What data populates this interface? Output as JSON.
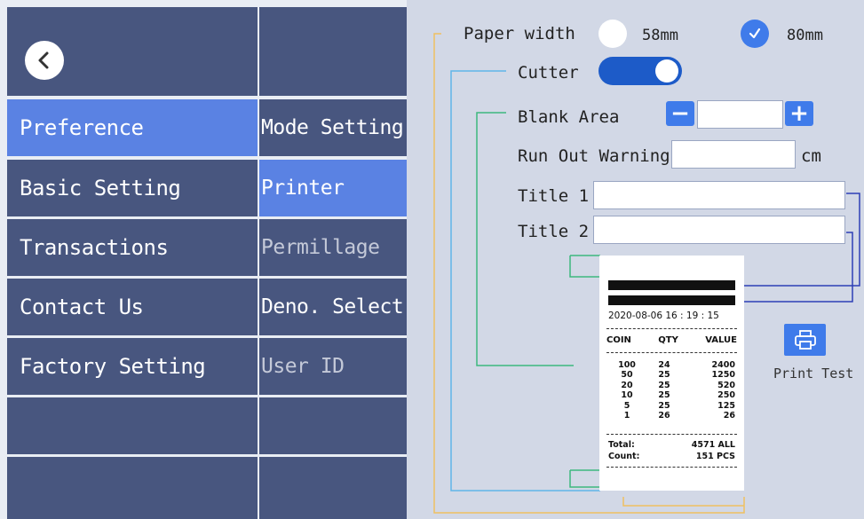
{
  "nav": {
    "back_icon": "chevron-left-icon",
    "primary": [
      "Preference",
      "Basic Setting",
      "Transactions",
      "Contact Us",
      "Factory Setting"
    ],
    "secondary": [
      "Mode Setting",
      "Printer",
      "Permillage",
      "Deno. Select",
      "User ID"
    ]
  },
  "printer": {
    "paper_width_label": "Paper width",
    "option_58": "58mm",
    "option_80": "80mm",
    "selected_width": "80mm",
    "cutter_label": "Cutter",
    "cutter_on": true,
    "blank_area_label": "Blank Area",
    "blank_area_value": "",
    "run_out_warning_label": "Run Out Warning",
    "run_out_warning_value": "",
    "run_out_unit": "cm",
    "title1_label": "Title 1",
    "title1_value": "",
    "title2_label": "Title 2",
    "title2_value": "",
    "print_test_label": "Print Test",
    "print_icon": "printer-icon"
  },
  "receipt": {
    "datetime": "2020-08-06 16 : 19 : 15",
    "headers": [
      "COIN",
      "QTY",
      "VALUE"
    ],
    "rows": [
      [
        "100",
        "24",
        "2400"
      ],
      [
        "50",
        "25",
        "1250"
      ],
      [
        "20",
        "25",
        "520"
      ],
      [
        "10",
        "25",
        "250"
      ],
      [
        "5",
        "25",
        "125"
      ],
      [
        "1",
        "26",
        "26"
      ]
    ],
    "total_label": "Total:",
    "total_value": "4571 ALL",
    "count_label": "Count:",
    "count_value": "151 PCS"
  },
  "colors": {
    "nav_bg": "#48567f",
    "nav_active": "#5a82e3",
    "accent": "#3f7bea",
    "panel_bg": "#d2d8e6"
  }
}
